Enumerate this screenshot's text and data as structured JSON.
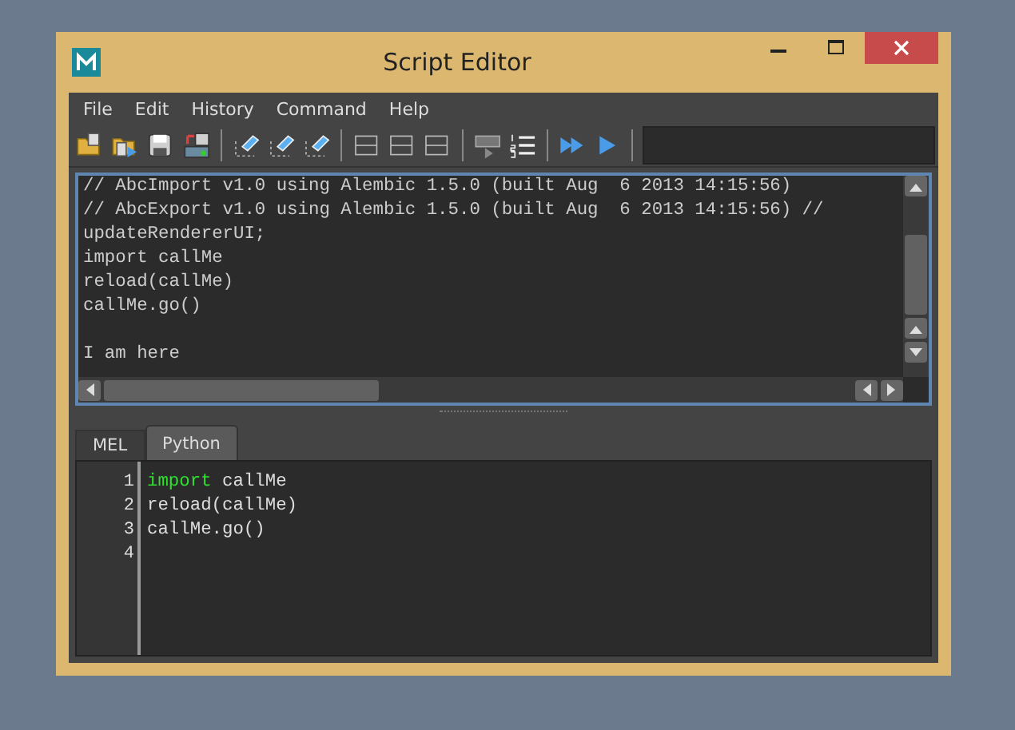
{
  "window": {
    "title": "Script Editor"
  },
  "menu": [
    "File",
    "Edit",
    "History",
    "Command",
    "Help"
  ],
  "toolbar": [
    {
      "kind": "open"
    },
    {
      "kind": "source"
    },
    {
      "kind": "save"
    },
    {
      "kind": "save-shelf"
    },
    {
      "kind": "sep"
    },
    {
      "kind": "clear"
    },
    {
      "kind": "clear"
    },
    {
      "kind": "clear"
    },
    {
      "kind": "sep"
    },
    {
      "kind": "pane"
    },
    {
      "kind": "pane"
    },
    {
      "kind": "pane"
    },
    {
      "kind": "sep"
    },
    {
      "kind": "echo"
    },
    {
      "kind": "numbers"
    },
    {
      "kind": "sep"
    },
    {
      "kind": "run-all"
    },
    {
      "kind": "run"
    },
    {
      "kind": "sep"
    },
    {
      "kind": "field"
    }
  ],
  "output": {
    "lines": [
      {
        "kind": "text",
        "text": "// AbcImport v1.0 using Alembic 1.5.0 (built Aug  6 2013 14:15:56)"
      },
      {
        "kind": "text",
        "text": "// AbcExport v1.0 using Alembic 1.5.0 (built Aug  6 2013 14:15:56) //"
      },
      {
        "kind": "text",
        "text": "updateRendererUI;"
      },
      {
        "kind": "text",
        "text": "import callMe"
      },
      {
        "kind": "text",
        "text": "reload(callMe)"
      },
      {
        "kind": "text",
        "text": "callMe.go()"
      },
      {
        "kind": "blank"
      },
      {
        "kind": "text",
        "text": "I am here"
      }
    ]
  },
  "tabs": [
    {
      "label": "MEL",
      "selected": false
    },
    {
      "label": "Python",
      "selected": true
    }
  ],
  "editor": {
    "lines": [
      {
        "number": "1",
        "tokens": [
          {
            "kind": "keyword",
            "text": "import"
          },
          {
            "kind": "plain",
            "text": " callMe"
          }
        ]
      },
      {
        "number": "2",
        "tokens": [
          {
            "kind": "plain",
            "text": "reload(callMe)"
          }
        ]
      },
      {
        "number": "3",
        "tokens": [
          {
            "kind": "plain",
            "text": "callMe.go()"
          }
        ]
      },
      {
        "number": "4"
      }
    ]
  }
}
